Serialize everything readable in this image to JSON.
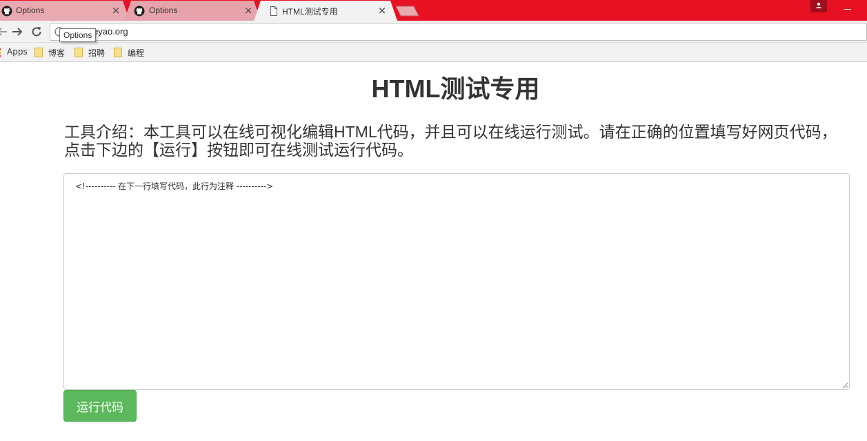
{
  "browser": {
    "tabs": [
      {
        "label": "Options",
        "icon": "github-icon",
        "active": false
      },
      {
        "label": "Options",
        "icon": "github-icon",
        "active": false
      },
      {
        "label": "HTML测试专用",
        "icon": "page-icon",
        "active": true
      }
    ],
    "close_glyph": "×",
    "address": {
      "url": "eyao.org"
    },
    "tooltip": "Options",
    "bookmarks": [
      {
        "label": "Apps",
        "icon": "apps-grid-icon"
      },
      {
        "label": "博客",
        "icon": "folder-icon"
      },
      {
        "label": "招聘",
        "icon": "folder-icon"
      },
      {
        "label": "编程",
        "icon": "folder-icon"
      }
    ],
    "colors": {
      "titlebar": "#e81123",
      "active_tab": "#f2f2f2",
      "inactive_tab": "#e6a3ab"
    }
  },
  "page": {
    "title": "HTML测试专用",
    "intro": "工具介绍：本工具可以在线可视化编辑HTML代码，并且可以在线运行测试。请在正确的位置填写好网页代码，点击下边的【运行】按钮即可在线测试运行代码。",
    "editor_value": "<!---------- 在下一行填写代码，此行为注释 ---------->",
    "run_button": "运行代码",
    "colors": {
      "run_button": "#5cb85c"
    }
  }
}
